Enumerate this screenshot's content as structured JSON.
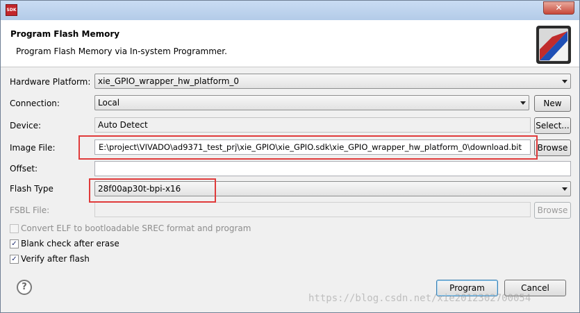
{
  "window": {
    "app_icon_text": "SDK",
    "close_icon": "close-icon"
  },
  "header": {
    "title": "Program Flash Memory",
    "description": "Program Flash Memory via In-system Programmer.",
    "logo_icon": "flash-memory-logo-icon"
  },
  "form": {
    "hardware_platform": {
      "label": "Hardware Platform:",
      "value": "xie_GPIO_wrapper_hw_platform_0"
    },
    "connection": {
      "label": "Connection:",
      "value": "Local",
      "button": "New"
    },
    "device": {
      "label": "Device:",
      "value": "Auto Detect",
      "button": "Select..."
    },
    "image_file": {
      "label": "Image File:",
      "value": "E:\\project\\VIVADO\\ad9371_test_prj\\xie_GPIO\\xie_GPIO.sdk\\xie_GPIO_wrapper_hw_platform_0\\download.bit",
      "button": "Browse"
    },
    "offset": {
      "label": "Offset:",
      "value": ""
    },
    "flash_type": {
      "label": "Flash Type",
      "value": "28f00ap30t-bpi-x16"
    },
    "fsbl_file": {
      "label": "FSBL File:",
      "value": "",
      "button": "Browse"
    }
  },
  "options": [
    {
      "label": "Convert ELF to bootloadable SREC format and program",
      "checked": false,
      "enabled": false
    },
    {
      "label": "Blank check after erase",
      "checked": true,
      "enabled": true
    },
    {
      "label": "Verify after flash",
      "checked": true,
      "enabled": true
    }
  ],
  "footer": {
    "help_icon": "help-icon",
    "program_button": "Program",
    "cancel_button": "Cancel"
  },
  "watermark": "https://blog.csdn.net/xie2012302700054",
  "colors": {
    "highlight": "#e03a3a"
  }
}
